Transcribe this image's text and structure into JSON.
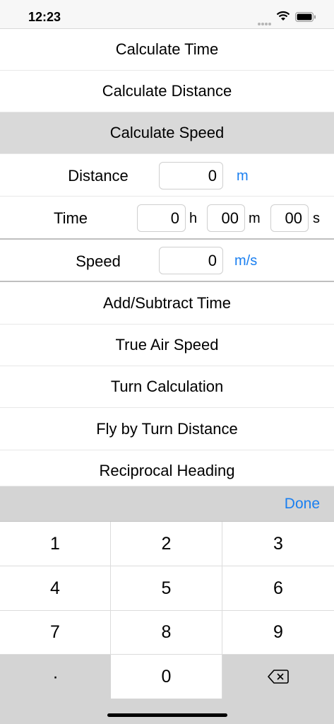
{
  "status": {
    "time": "12:23"
  },
  "menu_top": [
    {
      "label": "Calculate Time"
    },
    {
      "label": "Calculate Distance"
    },
    {
      "label": "Calculate Speed",
      "selected": true
    }
  ],
  "form": {
    "distance": {
      "label": "Distance",
      "value": "0",
      "unit": "m"
    },
    "time": {
      "label": "Time",
      "hours": "0",
      "hours_unit": "h",
      "minutes": "00",
      "minutes_unit": "m",
      "seconds": "00",
      "seconds_unit": "s"
    },
    "speed": {
      "label": "Speed",
      "value": "0",
      "unit": "m/s"
    }
  },
  "menu_bottom": [
    {
      "label": "Add/Subtract Time"
    },
    {
      "label": "True Air Speed"
    },
    {
      "label": "Turn Calculation"
    },
    {
      "label": "Fly by Turn Distance"
    },
    {
      "label": "Reciprocal Heading"
    }
  ],
  "keyboard": {
    "done_label": "Done",
    "keys": [
      "1",
      "2",
      "3",
      "4",
      "5",
      "6",
      "7",
      "8",
      "9",
      "·",
      "0"
    ],
    "accent_color": "#1a7ff0"
  }
}
